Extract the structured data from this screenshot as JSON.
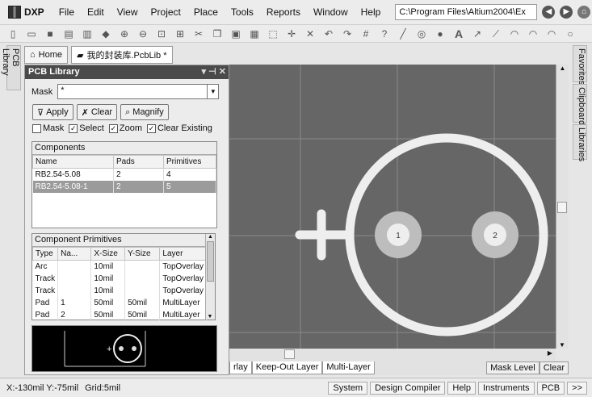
{
  "app": {
    "name": "DXP",
    "path": "C:\\Program Files\\Altium2004\\Ex"
  },
  "menu": [
    "File",
    "Edit",
    "View",
    "Project",
    "Place",
    "Tools",
    "Reports",
    "Window",
    "Help"
  ],
  "left_tab": "PCB Library",
  "doc_tabs": {
    "home": "Home",
    "file": "我的封装库.PcbLib *"
  },
  "panel": {
    "title": "PCB Library",
    "mask_label": "Mask",
    "mask_value": "*",
    "buttons": {
      "apply": "Apply",
      "clear": "Clear",
      "magnify": "Magnify"
    },
    "checks": [
      {
        "label": "Mask",
        "checked": false
      },
      {
        "label": "Select",
        "checked": true
      },
      {
        "label": "Zoom",
        "checked": true
      },
      {
        "label": "Clear Existing",
        "checked": true
      }
    ],
    "components": {
      "title": "Components",
      "headers": [
        "Name",
        "Pads",
        "Primitives"
      ],
      "rows": [
        {
          "name": "RB2.54-5.08",
          "pads": "2",
          "primitives": "4",
          "selected": false
        },
        {
          "name": "RB2.54-5.08-1",
          "pads": "2",
          "primitives": "5",
          "selected": true
        }
      ]
    },
    "primitives": {
      "title": "Component Primitives",
      "headers": [
        "Type",
        "Na...",
        "X-Size",
        "Y-Size",
        "Layer"
      ],
      "rows": [
        [
          "Arc",
          "",
          "10mil",
          "",
          "TopOverlay"
        ],
        [
          "Track",
          "",
          "10mil",
          "",
          "TopOverlay"
        ],
        [
          "Track",
          "",
          "10mil",
          "",
          "TopOverlay"
        ],
        [
          "Pad",
          "1",
          "50mil",
          "50mil",
          "MultiLayer"
        ],
        [
          "Pad",
          "2",
          "50mil",
          "50mil",
          "MultiLayer"
        ]
      ]
    }
  },
  "right_tabs": [
    "Favorites",
    "Clipboard",
    "Libraries"
  ],
  "canvas": {
    "pad1_label": "1",
    "pad2_label": "2"
  },
  "layer_tabs": [
    "rlay",
    "Keep-Out Layer",
    "Multi-Layer"
  ],
  "layer_buttons": {
    "mask_level": "Mask Level",
    "clear": "Clear"
  },
  "status": {
    "coords": "X:-130mil Y:-75mil",
    "grid": "Grid:5mil",
    "buttons": [
      "System",
      "Design Compiler",
      "Help",
      "Instruments",
      "PCB",
      ">>"
    ]
  },
  "colors": {
    "canvas": "#666666",
    "overlay": "#eeeeee",
    "pad": "#bdbdbd",
    "selected_row": "#9b9b9b"
  }
}
